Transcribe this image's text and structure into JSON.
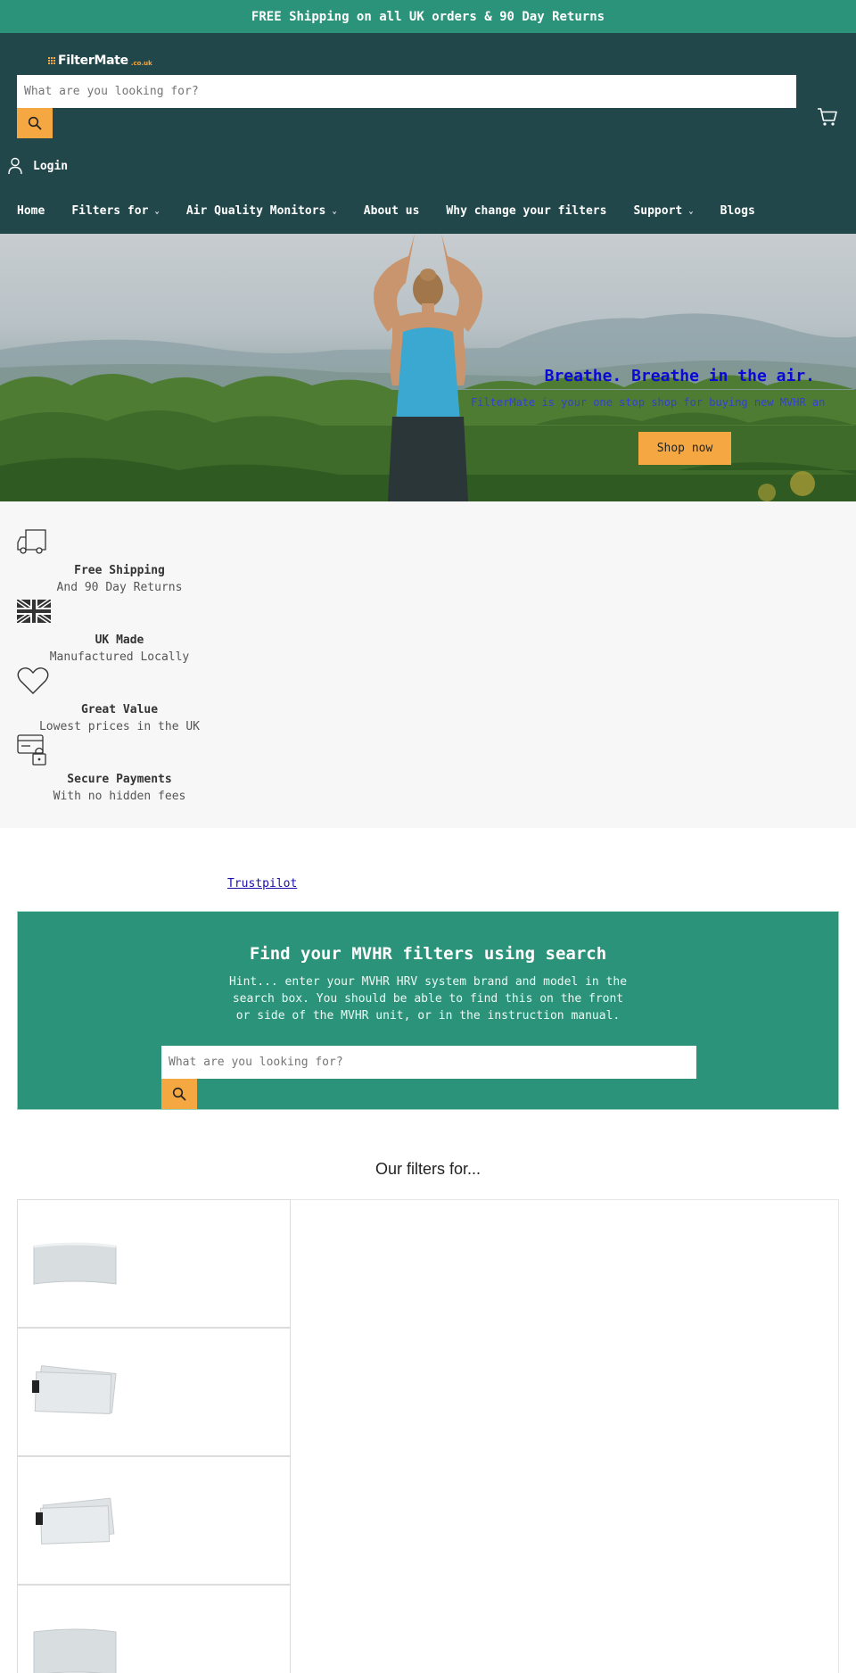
{
  "announcement": "FREE Shipping on all UK orders & 90 Day Returns",
  "header": {
    "logo_text": "FilterMate",
    "logo_tld": ".co.uk",
    "search_placeholder": "What are you looking for?",
    "search_icon": "search-icon",
    "cart_icon": "cart-icon",
    "login_label": "Login",
    "nav": [
      {
        "label": "Home"
      },
      {
        "label": "Filters for",
        "dropdown": true
      },
      {
        "label": "Air Quality Monitors",
        "dropdown": true
      },
      {
        "label": "About us"
      },
      {
        "label": "Why change your filters"
      },
      {
        "label": "Support",
        "dropdown": true
      },
      {
        "label": "Blogs"
      }
    ],
    "chevron": "⌄"
  },
  "hero": {
    "title": "Breathe. Breathe in the air.",
    "subtitle": "FilterMate is your one stop shop for buying new MVHR an",
    "button_label": "Shop now"
  },
  "features": [
    {
      "icon": "truck-icon",
      "title": "Free Shipping",
      "subtitle": "And 90 Day Returns"
    },
    {
      "icon": "uk-flag-icon",
      "title": "UK Made",
      "subtitle": "Manufactured Locally"
    },
    {
      "icon": "heart-icon",
      "title": "Great Value",
      "subtitle": "Lowest prices in the UK"
    },
    {
      "icon": "secure-card-icon",
      "title": "Secure Payments",
      "subtitle": "With no hidden fees"
    }
  ],
  "trustpilot": "Trustpilot",
  "mvhr_search": {
    "title": "Find your MVHR filters using search",
    "hint": "Hint... enter your MVHR HRV system brand and model in the search box. You should be able to find this on the front or side of the MVHR unit, or in the instruction manual.",
    "placeholder": "What are you looking for?"
  },
  "filters_heading": "Our filters for...",
  "colors": {
    "announcement_bg": "#2a937a",
    "header_bg": "#21474b",
    "accent": "#f5a742",
    "panel_bg": "#2a937a",
    "hero_title": "#0a0ad4"
  }
}
